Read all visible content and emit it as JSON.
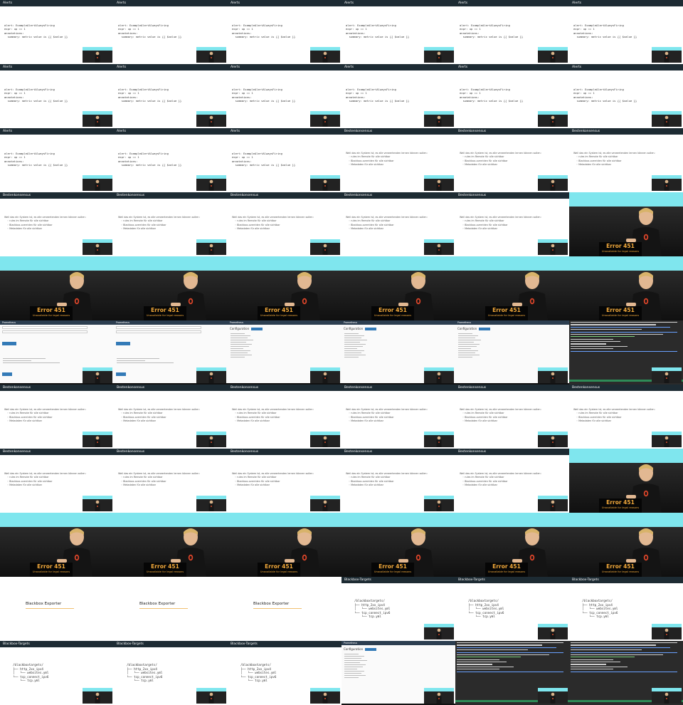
{
  "sheet": {
    "columns": 6,
    "rows": 11
  },
  "slides": {
    "alerts": {
      "title": "Alerts",
      "code": "alert: ExampleAlertAlwaysFiring\nexpr: up == 1\nannotations:\n  summary: metric value is {{ $value }}"
    },
    "bestenkonsens": {
      "title": "Bestenkonsensus",
      "lead": "Weil das ein System ist, es alle verwertenden lernen können sollen:",
      "bullets": "◦ rules im Remote für alle sichtbar\n◦ Blackbox-overriden für alle sichtbar\n◦ Metadaten für alle sichtbar"
    },
    "blackbox_exporter": {
      "title": "Blackbox Exporter"
    },
    "blackbox_targets": {
      "title": "Blackbox-Targets",
      "tree": "/blackboxtargets/\n├── http_2xx_ipv4\n│   └── websites.yml\n└── tcp_connect_ipv6\n    └── tcp.yml"
    }
  },
  "camera": {
    "error_code": "Error 451",
    "error_text": "Unavailable for legal reasons"
  },
  "screenshare": {
    "app_name": "Prometheus",
    "config_title": "Configuration"
  },
  "tiles": [
    "alerts",
    "alerts",
    "alerts",
    "alerts",
    "alerts",
    "alerts",
    "alerts",
    "alerts",
    "alerts",
    "alerts",
    "alerts",
    "alerts",
    "alerts",
    "alerts",
    "alerts",
    "bestenkonsens",
    "bestenkonsens",
    "bestenkonsens",
    "bestenkonsens",
    "bestenkonsens",
    "bestenkonsens",
    "bestenkonsens",
    "bestenkonsens",
    "camera",
    "camera",
    "camera",
    "camera",
    "camera",
    "camera",
    "camera",
    "ui-form",
    "ui-form",
    "ui-config",
    "ui-config",
    "ui-config",
    "terminal",
    "bestenkonsens",
    "bestenkonsens",
    "bestenkonsens",
    "bestenkonsens",
    "bestenkonsens",
    "bestenkonsens",
    "bestenkonsens",
    "bestenkonsens",
    "bestenkonsens",
    "bestenkonsens",
    "bestenkonsens",
    "camera",
    "camera",
    "camera",
    "camera",
    "camera",
    "camera",
    "camera",
    "blackbox-exporter",
    "blackbox-exporter",
    "blackbox-exporter",
    "blackbox-targets",
    "blackbox-targets",
    "blackbox-targets",
    "blackbox-targets",
    "blackbox-targets",
    "blackbox-targets",
    "ui-config",
    "terminal",
    "terminal"
  ]
}
